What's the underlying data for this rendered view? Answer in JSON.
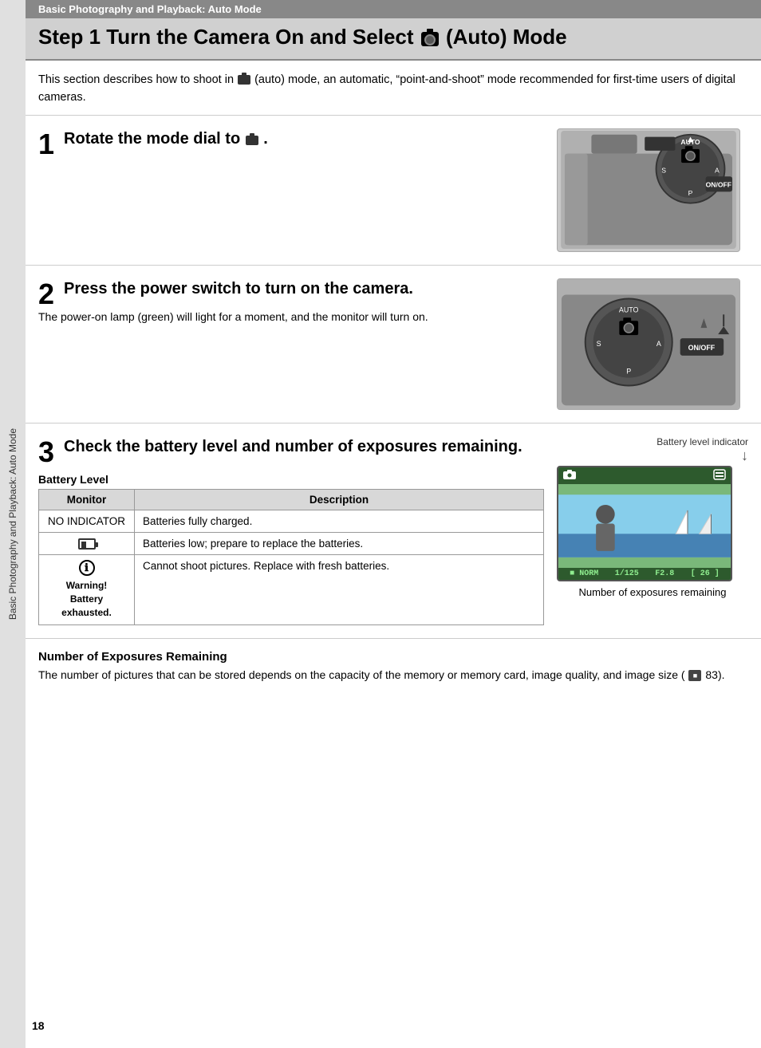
{
  "sidebar": {
    "label": "Basic Photography and Playback: Auto Mode"
  },
  "header": {
    "subtitle": "Basic Photography and Playback: Auto Mode",
    "title": "Step 1 Turn the Camera On and Select",
    "title_suffix": "(Auto) Mode"
  },
  "intro": {
    "text": "This section describes how to shoot in",
    "text2": "(auto) mode, an automatic, “point-and-shoot” mode recommended for first-time users of digital cameras."
  },
  "steps": [
    {
      "number": "1",
      "heading": "Rotate the mode dial to",
      "heading_suffix": ".",
      "body": ""
    },
    {
      "number": "2",
      "heading": "Press the power switch to turn on the camera.",
      "body": "The power-on lamp (green) will light for a moment, and the monitor will turn on."
    },
    {
      "number": "3",
      "heading": "Check the battery level and number of exposures remaining.",
      "body": ""
    }
  ],
  "battery": {
    "label": "Battery Level",
    "table_headers": [
      "Monitor",
      "Description"
    ],
    "rows": [
      {
        "monitor": "NO INDICATOR",
        "description": "Batteries fully charged."
      },
      {
        "monitor": "battery_icon",
        "description": "Batteries low; prepare to replace the batteries."
      },
      {
        "monitor": "warning_icon",
        "monitor_text": "Warning!\nBattery\nexexhausted.",
        "description": "Cannot shoot pictures. Replace with fresh batteries."
      }
    ],
    "indicator_label": "Battery level indicator",
    "exposures_label": "Number of exposures remaining"
  },
  "exposures": {
    "heading": "Number of Exposures Remaining",
    "text": "The number of pictures that can be stored depends on the capacity of the memory or memory card, image quality, and image size (",
    "text_suffix": "83)."
  },
  "lcd": {
    "top_left": "■",
    "shutter": "1/125",
    "aperture": "F2.8",
    "exposures": "26"
  },
  "page_number": "18"
}
